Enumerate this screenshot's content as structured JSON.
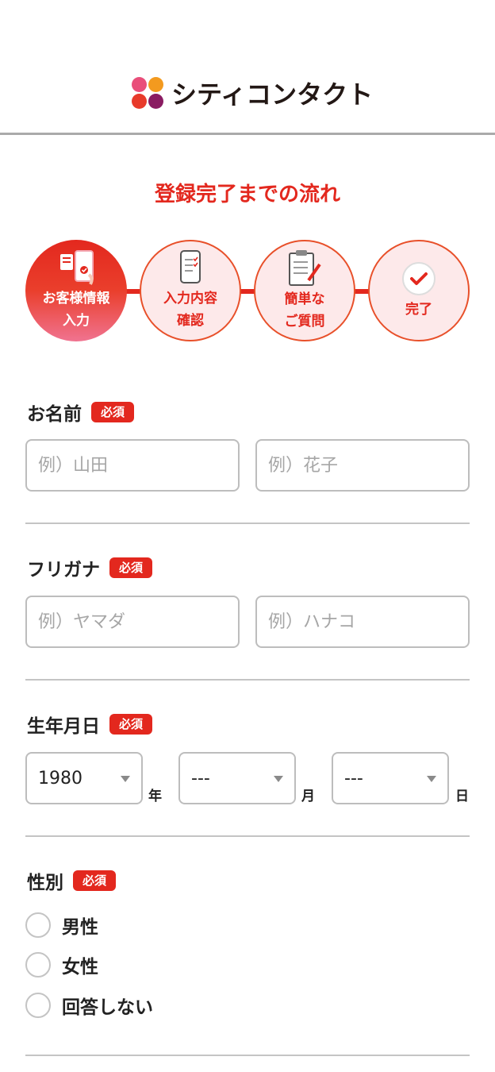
{
  "header": {
    "brand": "シティコンタクト",
    "logo_colors": [
      "#e94e7a",
      "#f39a1f",
      "#e83a2a",
      "#8a1c62"
    ]
  },
  "flow": {
    "title": "登録完了までの流れ",
    "steps": [
      {
        "label": "お客様情報\n入力",
        "icon": "phone-document-icon",
        "active": true
      },
      {
        "label": "入力内容\n確認",
        "icon": "smartphone-checklist-icon",
        "active": false
      },
      {
        "label": "簡単な\nご質問",
        "icon": "clipboard-pen-icon",
        "active": false
      },
      {
        "label": "完了",
        "icon": "check-circle-icon",
        "active": false
      }
    ]
  },
  "form": {
    "required_label": "必須",
    "name": {
      "label": "お名前",
      "last_placeholder": "例）山田",
      "first_placeholder": "例）花子"
    },
    "furigana": {
      "label": "フリガナ",
      "last_placeholder": "例）ヤマダ",
      "first_placeholder": "例）ハナコ"
    },
    "birthday": {
      "label": "生年月日",
      "year_value": "1980",
      "year_unit": "年",
      "month_value": "---",
      "month_unit": "月",
      "day_value": "---",
      "day_unit": "日"
    },
    "gender": {
      "label": "性別",
      "options": [
        "男性",
        "女性",
        "回答しない"
      ]
    }
  },
  "colors": {
    "accent": "#e3281e",
    "border": "#bdbdbd"
  }
}
